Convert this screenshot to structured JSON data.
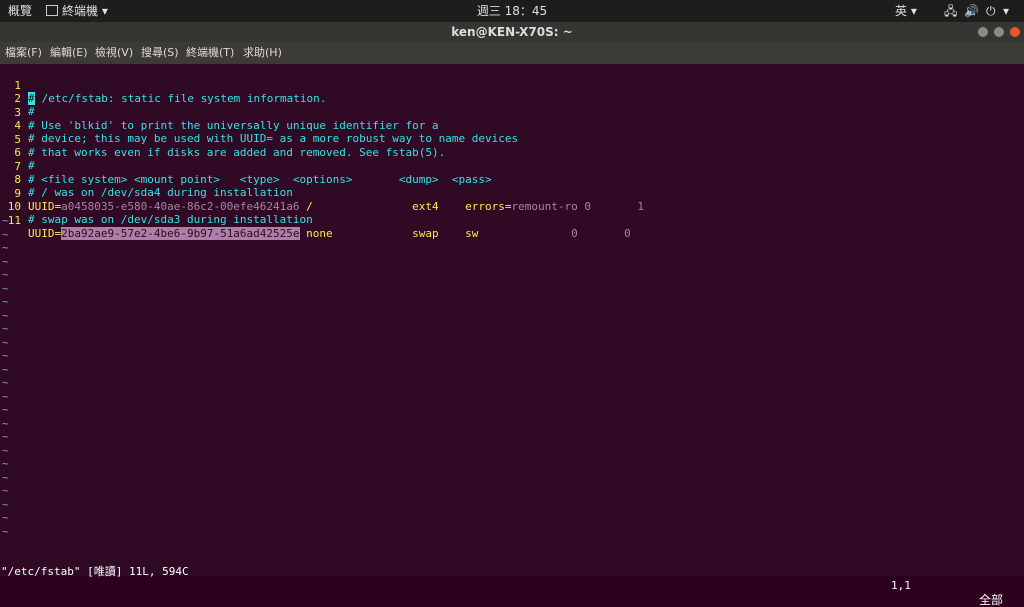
{
  "topbar": {
    "activities": "概覽",
    "app_menu": "終端機",
    "clock": "週三 18：45",
    "input_method": "英"
  },
  "window": {
    "title": "ken@KEN-X70S: ~"
  },
  "menus": [
    "檔案(F)",
    "編輯(E)",
    "檢視(V)",
    "搜尋(S)",
    "終端機(T)",
    "求助(H)"
  ],
  "file_lines": [
    {
      "n": "1",
      "text": " /etc/fstab: static file system information."
    },
    {
      "n": "2",
      "text": "#"
    },
    {
      "n": "3",
      "text": "# Use 'blkid' to print the universally unique identifier for a"
    },
    {
      "n": "4",
      "text": "# device; this may be used with UUID= as a more robust way to name devices"
    },
    {
      "n": "5",
      "text": "# that works even if disks are added and removed. See fstab(5)."
    },
    {
      "n": "6",
      "text": "#"
    },
    {
      "n": "7",
      "text": "# <file system> <mount point>   <type>  <options>       <dump>  <pass>"
    },
    {
      "n": "8",
      "text": "# / was on /dev/sda4 during installation"
    },
    {
      "n": "9",
      "uuid_key": "UUID=",
      "uuid_val": "a0458035-e580-40ae-86c2-00efe46241a6",
      "rest1": " /               ",
      "fs": "ext4",
      "gap": "    ",
      "opt": "errors",
      "eq": "=",
      "optval": "remount-ro",
      "tail": " 0       1"
    },
    {
      "n": "10",
      "text": "# swap was on /dev/sda3 during installation"
    },
    {
      "n": "11",
      "uuid_key": "UUID=",
      "uuid_hl": "2ba92ae9-57e2-4be6-9b97-51a6ad42525e",
      "rest1": " none            ",
      "fs": "swap",
      "gap": "    ",
      "opt": "sw",
      "tail": "              0       0"
    }
  ],
  "cursor_char": "#",
  "tilde": "~",
  "status": {
    "left": "\"/etc/fstab\" [唯讀] 11L, 594C",
    "position": "1,1",
    "scroll": "全部"
  },
  "colors": {
    "terminal_bg": "#300a24",
    "comment": "#34e2e2",
    "keyword": "#fce94f",
    "value": "#ad7fa8",
    "tilde": "#729fcf"
  }
}
